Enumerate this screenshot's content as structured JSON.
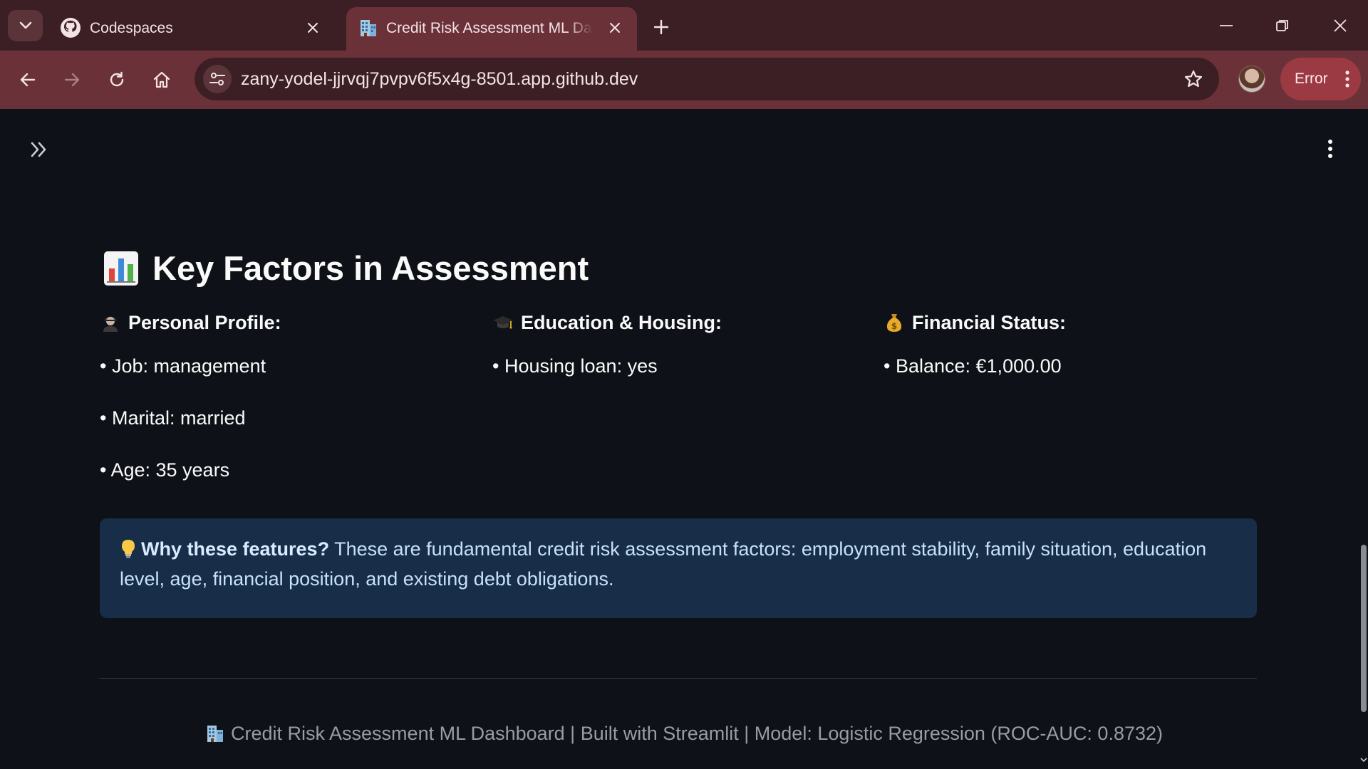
{
  "browser": {
    "tabs": [
      {
        "title": "Codespaces",
        "favicon": "github-icon",
        "active": false
      },
      {
        "title": "Credit Risk Assessment ML Dashboard",
        "favicon": "office-building-icon",
        "active": true
      }
    ],
    "url": "zany-yodel-jjrvqj7pvpv6f5x4g-8501.app.github.dev",
    "error_label": "Error",
    "colors": {
      "frame": "#3c1f24",
      "toolbar": "#6b3138",
      "error_chip": "#9c3a44"
    }
  },
  "section": {
    "icon": "bar-chart-icon",
    "title": "Key Factors in Assessment"
  },
  "columns": [
    {
      "icon": "person-icon",
      "heading": "Personal Profile:",
      "items": [
        "• Job: management",
        "• Marital: married",
        "• Age: 35 years"
      ]
    },
    {
      "icon": "graduation-cap-icon",
      "heading": "Education & Housing:",
      "items": [
        "• Housing loan: yes"
      ]
    },
    {
      "icon": "money-bag-icon",
      "heading": "Financial Status:",
      "items": [
        "• Balance: €1,000.00"
      ]
    }
  ],
  "info": {
    "icon": "lightbulb-icon",
    "bold": "Why these features?",
    "text": " These are fundamental credit risk assessment factors: employment stability, family situation, education level, age, financial position, and existing debt obligations."
  },
  "footer": {
    "icon": "office-building-icon",
    "text": "Credit Risk Assessment ML Dashboard | Built with Streamlit | Model: Logistic Regression (ROC-AUC: 0.8732)"
  },
  "theme": {
    "background": "#0e1117",
    "info_bg": "#172d48",
    "info_text": "#c7e1fb"
  }
}
